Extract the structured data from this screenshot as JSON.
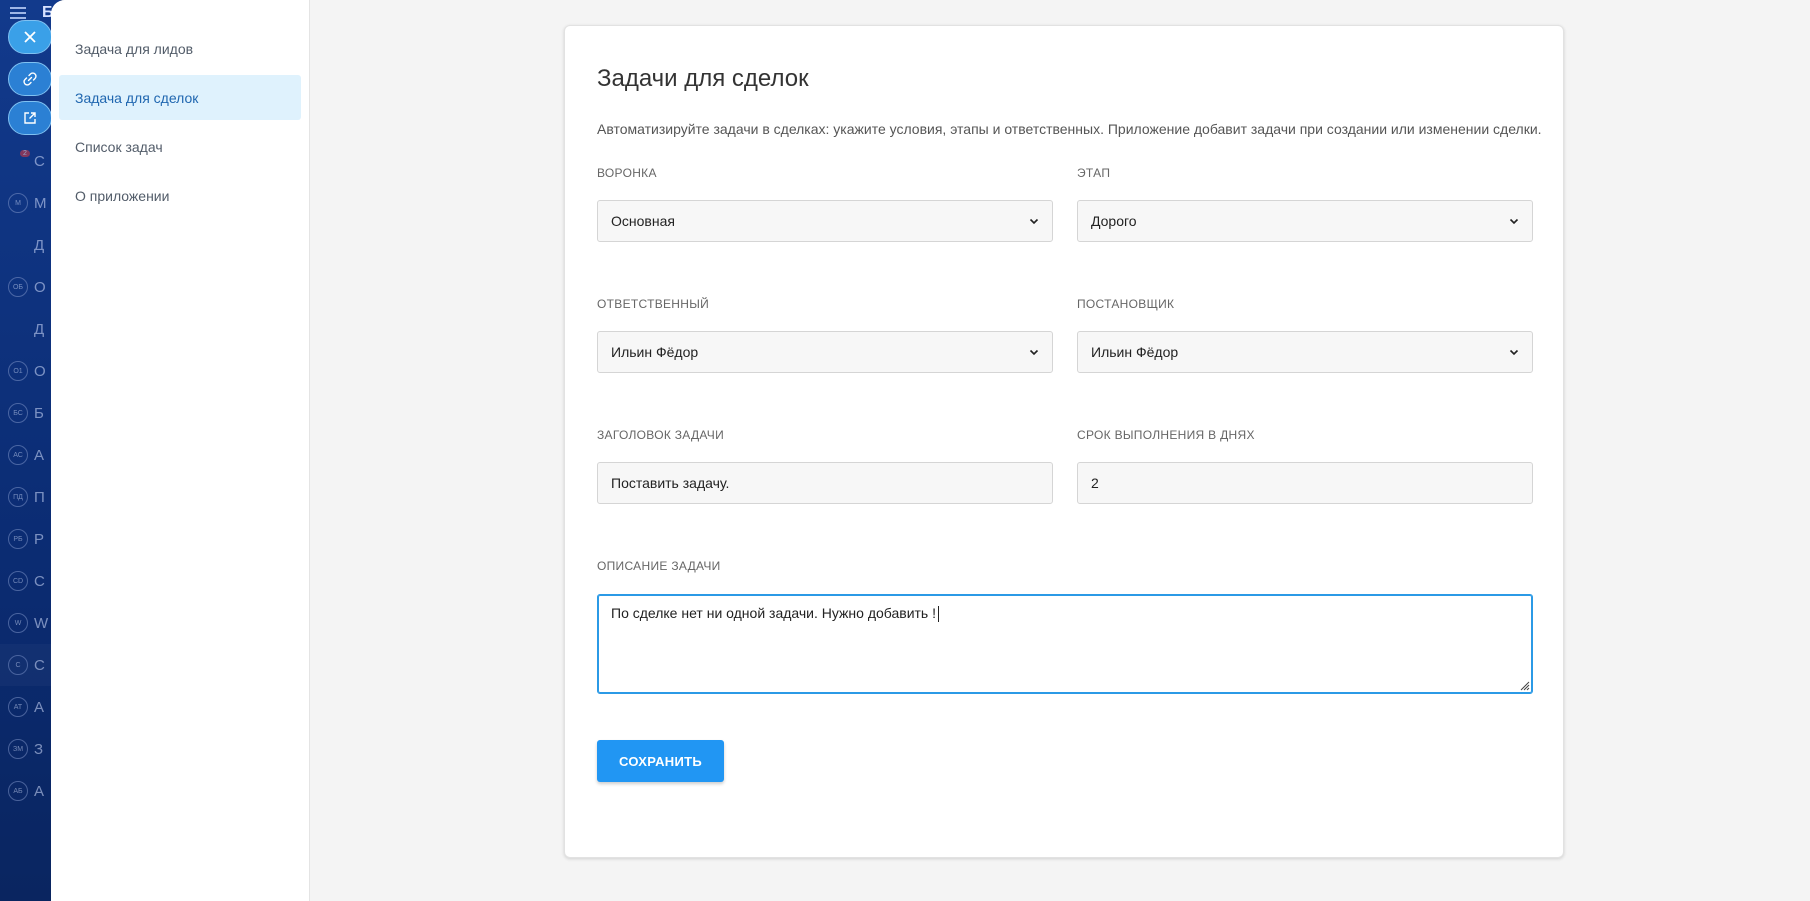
{
  "background_app": {
    "letter": "Б",
    "items": [
      {
        "icon": "filter-icon",
        "text": "С",
        "badge": "2"
      },
      {
        "icon": "M",
        "text": "М"
      },
      {
        "icon": "house-icon",
        "text": "Д"
      },
      {
        "icon": "ОБ",
        "text": "О"
      },
      {
        "icon": "presentation-icon",
        "text": "Д"
      },
      {
        "icon": "О1",
        "text": "О"
      },
      {
        "icon": "БС",
        "text": "Б"
      },
      {
        "icon": "АС",
        "text": "А"
      },
      {
        "icon": "ПД",
        "text": "П"
      },
      {
        "icon": "РБ",
        "text": "Р"
      },
      {
        "icon": "СD",
        "text": "С"
      },
      {
        "icon": "W",
        "text": "W"
      },
      {
        "icon": "С",
        "text": "С"
      },
      {
        "icon": "АТ",
        "text": "А"
      },
      {
        "icon": "ЗМ",
        "text": "З"
      },
      {
        "icon": "АБ",
        "text": "А"
      }
    ]
  },
  "floating_buttons": {
    "close": "close-icon",
    "link": "link-icon",
    "open": "external-link-icon"
  },
  "nav": {
    "items": [
      {
        "label": "Задача для лидов",
        "active": false
      },
      {
        "label": "Задача для сделок",
        "active": true
      },
      {
        "label": "Список задач",
        "active": false
      },
      {
        "label": "О приложении",
        "active": false
      }
    ]
  },
  "form": {
    "title": "Задачи для сделок",
    "description": "Автоматизируйте задачи в сделках: укажите условия, этапы и ответственных. Приложение добавит задачи при создании или изменении сделки.",
    "funnel": {
      "label": "Воронка",
      "value": "Основная"
    },
    "stage": {
      "label": "Этап",
      "value": "Дорого"
    },
    "responsible": {
      "label": "Ответственный",
      "value": "Ильин Фёдор"
    },
    "creator": {
      "label": "Постановщик",
      "value": "Ильин Фёдор"
    },
    "task_title": {
      "label": "Заголовок задачи",
      "value": "Поставить задачу."
    },
    "deadline": {
      "label": "Срок выполнения в днях",
      "value": "2"
    },
    "task_description": {
      "label": "Описание задачи",
      "value": "По сделке нет ни одной задачи. Нужно добавить !"
    },
    "save_label": "Сохранить"
  },
  "colors": {
    "accent": "#2196f3",
    "active_nav_bg": "#dff2fd",
    "active_nav_text": "#2067b0",
    "background_app": "#0b2a6b"
  }
}
